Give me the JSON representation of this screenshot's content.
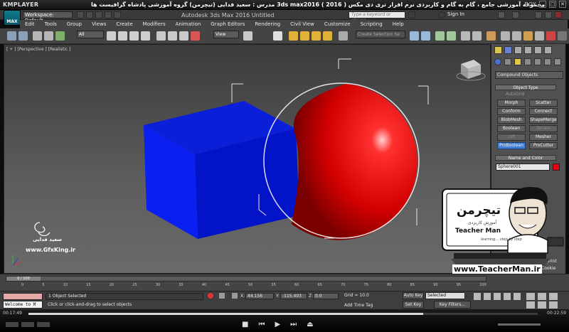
{
  "player": {
    "name": "KMPLAYER",
    "title": "مجموعه آموزشی جامع ، گام به گام و کاربردی نرم افزار تری دی مکس 3ds max2016 ( 2016 )   مدرس : سعید فدایی (تیچرمن) گروه آموزشی پادشاه گرافیست ها",
    "right_label": "BOX",
    "time_current": "00:17:49",
    "time_total": "00:22:59",
    "progress": 0.775
  },
  "max": {
    "logo_text": "MAX",
    "workspace": "Workspace: Default",
    "app_title": "Autodesk 3ds Max 2016     Untitled",
    "search_placeholder": "Type a keyword or phrase",
    "signin": "Sign In"
  },
  "menu": [
    "Edit",
    "Tools",
    "Group",
    "Views",
    "Create",
    "Modifiers",
    "Animation",
    "Graph Editors",
    "Rendering",
    "Civil View",
    "Customize",
    "Scripting",
    "Help"
  ],
  "toolbar": {
    "filter": "All",
    "ref_coord": "View",
    "selection_set": "Create Selection Se"
  },
  "viewport": {
    "label": "[ + ] [Perspective ] [Realistic ]",
    "watermark_name": "سعید فدایی",
    "watermark_site": "www.GfxKing.ir"
  },
  "command_panel": {
    "category": "Compound Objects",
    "object_type_header": "Object Type",
    "autogrid": "AutoGrid",
    "buttons": [
      "Morph",
      "Scatter",
      "Conform",
      "Connect",
      "BlobMesh",
      "ShapeMerge",
      "Boolean",
      "Terrain",
      "Loft",
      "Mesher",
      "ProBoolean",
      "ProCutter"
    ],
    "name_color_header": "Name and Color",
    "object_name": "Sphere001",
    "object_color": "#e8000e",
    "imprint": "Imprint",
    "cookie": "Cookie"
  },
  "teacher_panel": {
    "logo_fa": "تیچرمن",
    "tagline_fa": "آموزش کاربردی",
    "name": "Teacher Man",
    "learning": "learning... step by step",
    "url": "www.TeacherMan.ir"
  },
  "track": {
    "frame": "0 / 100",
    "ticks": [
      "0",
      "5",
      "10",
      "15",
      "20",
      "25",
      "30",
      "35",
      "40",
      "45",
      "50",
      "55",
      "60",
      "65",
      "70",
      "75",
      "80",
      "85",
      "90",
      "95",
      "100"
    ]
  },
  "status": {
    "maxscript": "Welcome to M",
    "selected": "1 Object Selected",
    "prompt": "Click or click-and-drag to select objects",
    "x": "44.156",
    "y": "-115.403",
    "z": "0.0",
    "grid": "Grid = 10.0",
    "add_time_tag": "Add Time Tag",
    "auto_key": "Auto Key",
    "set_key": "Set Key",
    "key_mode": "Selected",
    "key_filters": "Key Filters...",
    "x_label": "X:",
    "y_label": "Y:",
    "z_label": "Z:"
  }
}
